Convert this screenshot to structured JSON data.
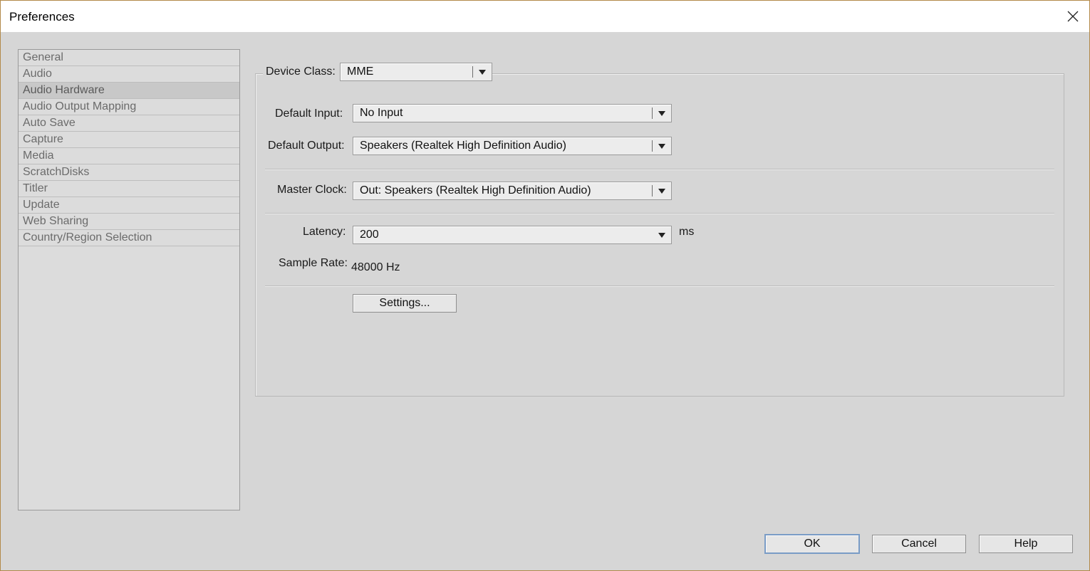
{
  "window": {
    "title": "Preferences"
  },
  "sidebar": {
    "items": [
      {
        "label": "General"
      },
      {
        "label": "Audio"
      },
      {
        "label": "Audio Hardware",
        "selected": true
      },
      {
        "label": "Audio Output Mapping"
      },
      {
        "label": "Auto Save"
      },
      {
        "label": "Capture"
      },
      {
        "label": "Media"
      },
      {
        "label": "ScratchDisks"
      },
      {
        "label": "Titler"
      },
      {
        "label": "Update"
      },
      {
        "label": "Web Sharing"
      },
      {
        "label": "Country/Region Selection"
      }
    ]
  },
  "audio_hardware": {
    "device_class": {
      "label": "Device Class:",
      "value": "MME"
    },
    "default_input": {
      "label": "Default Input:",
      "value": "No Input"
    },
    "default_output": {
      "label": "Default Output:",
      "value": "Speakers (Realtek High Definition Audio)"
    },
    "master_clock": {
      "label": "Master Clock:",
      "value": "Out: Speakers (Realtek High Definition Audio)"
    },
    "latency": {
      "label": "Latency:",
      "value": "200",
      "unit": "ms"
    },
    "sample_rate": {
      "label": "Sample Rate:",
      "value": "48000 Hz"
    },
    "settings_button": "Settings..."
  },
  "footer": {
    "ok": "OK",
    "cancel": "Cancel",
    "help": "Help"
  },
  "colors": {
    "background": "#d6d6d6",
    "default_button_border": "#7a9cc6",
    "window_border": "#b28a4a"
  }
}
